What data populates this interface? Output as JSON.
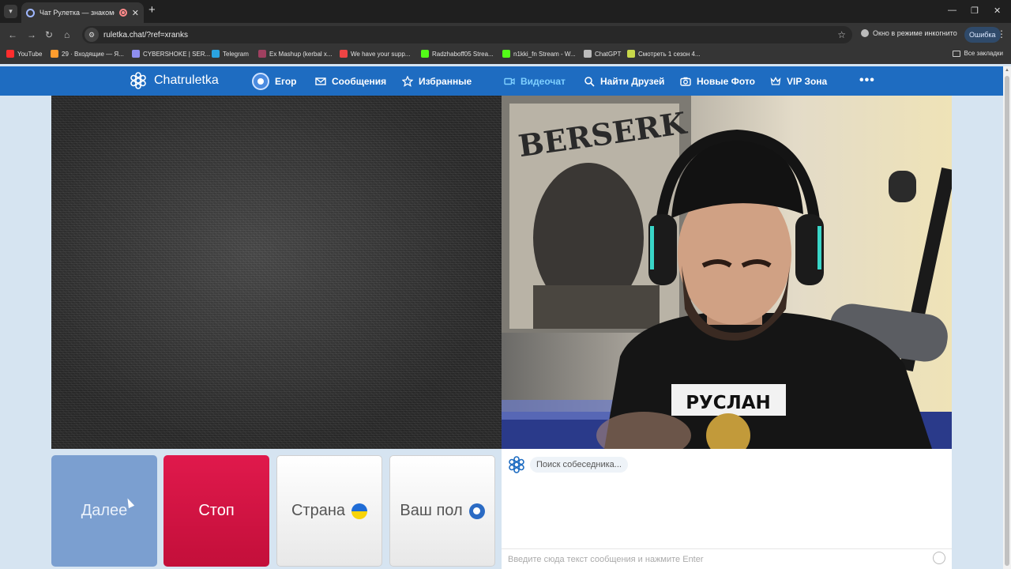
{
  "browser": {
    "tab_title": "Чат Рулетка — знакомства",
    "url": "ruletka.chat/?ref=xranks",
    "incognito_label": "Окно в режиме инкогнито",
    "error_pill": "Ошибка",
    "bookmarks": [
      {
        "label": "YouTube",
        "color": "#ff2d2d"
      },
      {
        "label": "29 · Входящие — Я...",
        "color": "#ff9d2e"
      },
      {
        "label": "CYBERSHOKE | SER...",
        "color": "#8e8ef0"
      },
      {
        "label": "Telegram",
        "color": "#2aa3e0"
      },
      {
        "label": "Ex Mashup (kerbal x...",
        "color": "#a04060"
      },
      {
        "label": "We have your supp...",
        "color": "#e44"
      },
      {
        "label": "Radzhaboff05 Strea...",
        "color": "#53fc18"
      },
      {
        "label": "n1kki_fn Stream - W...",
        "color": "#53fc18"
      },
      {
        "label": "ChatGPT",
        "color": "#bbbbbb"
      },
      {
        "label": "Смотреть 1 сезон 4...",
        "color": "#c8d84a"
      }
    ],
    "all_bookmarks": "Все закладки"
  },
  "site": {
    "logo": "Chatruletka",
    "nav": {
      "user": "Егор",
      "messages": "Сообщения",
      "favorites": "Избранные",
      "videochat": "Видеочат",
      "find_friends": "Найти Друзей",
      "new_photos": "Новые Фото",
      "vip": "VIP Зона"
    },
    "accent": "#1e6cc1",
    "active_color": "#7fd0ff"
  },
  "controls": {
    "next": "Далее",
    "stop": "Стоп",
    "country": "Страна",
    "gender": "Ваш пол"
  },
  "chat": {
    "status": "Поиск собеседника...",
    "placeholder": "Введите сюда текст сообщения и нажмите Enter"
  },
  "stream_overlay": {
    "shirt_text": "РУСЛАН",
    "poster_text": "BERSERK"
  }
}
